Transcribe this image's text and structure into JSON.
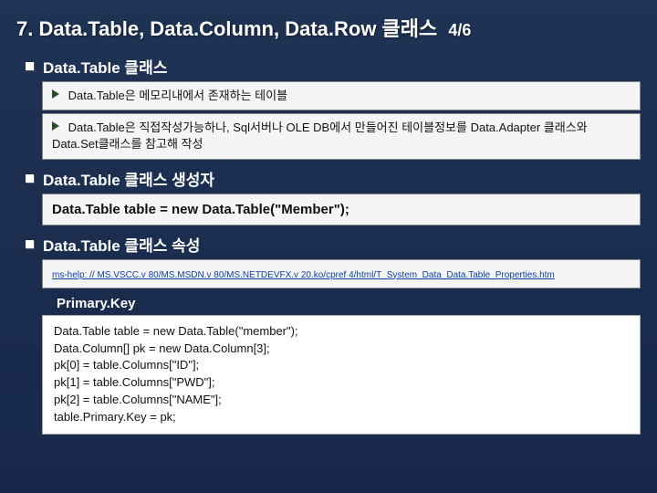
{
  "title": "7. Data.Table, Data.Column, Data.Row 클래스",
  "page_indicator": "4/6",
  "sections": {
    "class_intro": {
      "heading": "Data.Table 클래스",
      "point1": "Data.Table은 메모리내에서 존재하는 테이블",
      "point2": "Data.Table은 직접작성가능하나, Sql서버나 OLE DB에서 만들어진 테이블정보를 Data.Adapter 클래스와 Data.Set클래스를 참고해 작성"
    },
    "constructor": {
      "heading": "Data.Table 클래스 생성자",
      "code": "Data.Table table = new Data.Table(\"Member\");"
    },
    "properties": {
      "heading": "Data.Table 클래스 속성",
      "link_text": "ms-help: // MS.VSCC.v 80/MS.MSDN.v 80/MS.NETDEVFX.v 20.ko/cpref 4/html/T_System_Data_Data.Table_Properties.htm",
      "primary_key_label": "Primary.Key",
      "code_lines": [
        "Data.Table table = new Data.Table(\"member\");",
        "Data.Column[] pk = new Data.Column[3];",
        "pk[0] = table.Columns[\"ID\"];",
        "pk[1] = table.Columns[\"PWD\"];",
        "pk[2] = table.Columns[\"NAME\"];",
        "table.Primary.Key = pk;"
      ]
    }
  }
}
